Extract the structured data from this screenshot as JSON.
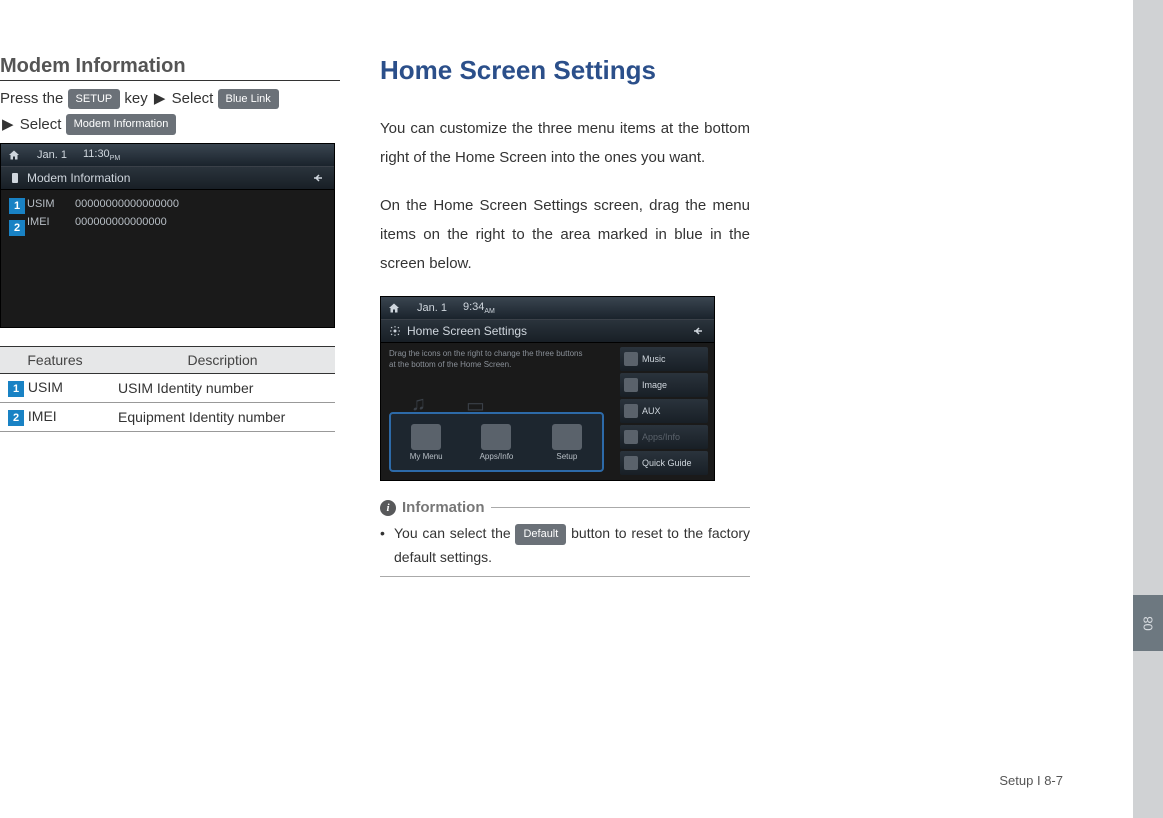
{
  "leftColumn": {
    "sectionTitle": "Modem Information",
    "instrPrefix": "Press the",
    "setupKey": "SETUP",
    "instrKey": "key",
    "arrow": "▶",
    "selectWord": "Select",
    "blueLink": "Blue Link",
    "modemInfo": "Modem Information",
    "screenshot": {
      "date": "Jan. 1",
      "time": "11:30",
      "ampm": "PM",
      "title": "Modem Information",
      "rows": [
        {
          "label": "USIM",
          "value": "00000000000000000"
        },
        {
          "label": "IMEI",
          "value": "000000000000000"
        }
      ]
    },
    "table": {
      "headers": {
        "features": "Features",
        "description": "Description"
      },
      "rows": [
        {
          "num": "1",
          "feature": "USIM",
          "desc": "USIM Identity number"
        },
        {
          "num": "2",
          "feature": "IMEI",
          "desc": "Equipment Identity number"
        }
      ]
    }
  },
  "rightColumn": {
    "title": "Home Screen Settings",
    "para1": "You can customize the three menu items at the bottom right of the Home Screen into the ones you want.",
    "para2": "On the Home Screen Settings screen, drag the menu items on the right to the area marked in blue in the screen below.",
    "screenshot": {
      "date": "Jan. 1",
      "time": "9:34",
      "ampm": "AM",
      "title": "Home Screen Settings",
      "hint": "Drag the icons on the right to change the three buttons at the bottom of the Home Screen.",
      "sideItems": [
        "Music",
        "Image",
        "AUX",
        "Apps/Info",
        "Quick Guide"
      ],
      "slots": [
        "My Menu",
        "Apps/Info",
        "Setup"
      ]
    },
    "info": {
      "heading": "Information",
      "bulletPrefix": "You can select the",
      "defaultBtn": "Default",
      "bulletSuffix": "button to reset to the factory default settings."
    }
  },
  "footer": "Setup I 8-7",
  "sideTab": "08"
}
